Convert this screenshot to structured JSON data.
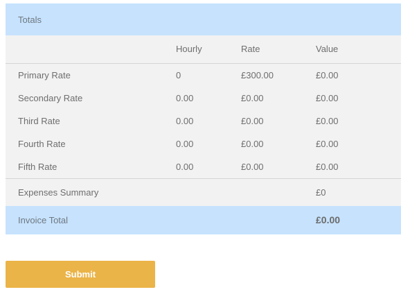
{
  "totals": {
    "title": "Totals"
  },
  "columns": {
    "label": "",
    "hourly": "Hourly",
    "rate": "Rate",
    "value": "Value"
  },
  "rates": [
    {
      "label": "Primary Rate",
      "hourly": "0",
      "rate": "£300.00",
      "value": "£0.00"
    },
    {
      "label": "Secondary Rate",
      "hourly": "0.00",
      "rate": "£0.00",
      "value": "£0.00"
    },
    {
      "label": "Third Rate",
      "hourly": "0.00",
      "rate": "£0.00",
      "value": "£0.00"
    },
    {
      "label": "Fourth Rate",
      "hourly": "0.00",
      "rate": "£0.00",
      "value": "£0.00"
    },
    {
      "label": "Fifth Rate",
      "hourly": "0.00",
      "rate": "£0.00",
      "value": "£0.00"
    }
  ],
  "expenses": {
    "label": "Expenses Summary",
    "value": "£0"
  },
  "invoice": {
    "label": "Invoice Total",
    "value": "£0.00"
  },
  "form": {
    "submit_label": "Submit"
  },
  "colors": {
    "header_background": "#c6e2fd",
    "table_background": "#f2f2f2",
    "submit_background": "#ebb448"
  }
}
